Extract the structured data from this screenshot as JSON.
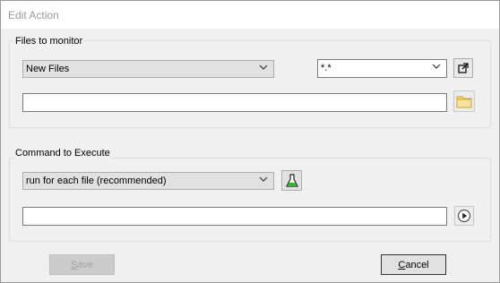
{
  "window": {
    "title": "Edit Action"
  },
  "monitor_group": {
    "legend": "Files to monitor",
    "type_select": {
      "value": "New Files"
    },
    "mask_select": {
      "value": "*.*"
    },
    "path_input": {
      "value": ""
    }
  },
  "command_group": {
    "legend": "Command to Execute",
    "mode_select": {
      "value": "run for each file  (recommended)"
    },
    "command_input": {
      "value": ""
    }
  },
  "buttons": {
    "save": {
      "mnemonic": "S",
      "rest": "ave"
    },
    "cancel": {
      "mnemonic": "C",
      "rest": "ancel"
    }
  },
  "icons": {
    "open_external": "external-link-icon",
    "browse": "folder-icon",
    "test": "flask-icon",
    "run": "play-icon"
  },
  "colors": {
    "flask": "#2eb82e",
    "folder": "#f3d679",
    "disabled_text": "#a0a0a0"
  }
}
